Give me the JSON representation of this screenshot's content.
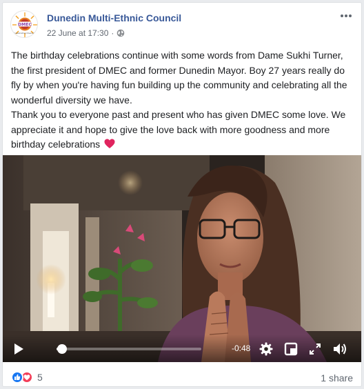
{
  "post": {
    "page_name": "Dunedin Multi-Ethnic Council",
    "timestamp": "22 June at 17:30",
    "separator": "·",
    "privacy_icon": "globe-icon",
    "avatar": {
      "logo_text": "DMEC",
      "logo_tagline": "Celebrating Diversity"
    },
    "paragraph1": "The birthday celebrations continue with some words from Dame Sukhi Turner, the first president of DMEC and former Dunedin Mayor. Boy 27 years really do fly by when you're having fun building up the community and celebrating all the wonderful diversity we have.",
    "paragraph2": "Thank you to everyone past and present who has given DMEC some love. We appreciate it and hope to give the love back with more goodness and more birthday celebrations",
    "emoji": "red-heart-icon"
  },
  "video": {
    "time_remaining": "-0:48",
    "progress_fraction": 0.04,
    "controls": [
      "play-icon",
      "gear-icon",
      "miniplayer-icon",
      "fullscreen-icon",
      "volume-icon"
    ]
  },
  "footer": {
    "reaction_icons": [
      "like-icon",
      "love-icon"
    ],
    "reaction_count": "5",
    "shares": "1 share"
  },
  "colors": {
    "link_blue": "#385898",
    "like_blue": "#1877f2",
    "love_red": "#f33e58",
    "secondary_text": "#606770"
  }
}
